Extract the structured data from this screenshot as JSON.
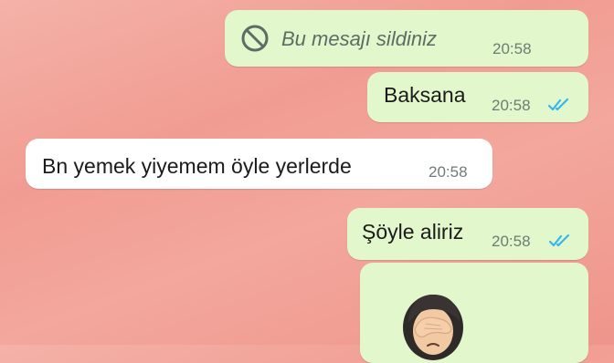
{
  "messages": [
    {
      "id": "m1",
      "direction": "outgoing",
      "deleted": true,
      "text": "Bu mesajı sildiniz",
      "time": "20:58",
      "icon": "ban-icon"
    },
    {
      "id": "m2",
      "direction": "outgoing",
      "text": "Baksana",
      "time": "20:58",
      "status": "read"
    },
    {
      "id": "m3",
      "direction": "incoming",
      "text": "Bn yemek yiyemem öyle yerlerde",
      "time": "20:58"
    },
    {
      "id": "m4",
      "direction": "outgoing",
      "text": "Şöyle aliriz",
      "time": "20:58",
      "status": "read"
    },
    {
      "id": "m5",
      "direction": "outgoing",
      "type": "emoji",
      "emoji": "woman-facepalming"
    }
  ],
  "colors": {
    "outgoing_bubble": "#e2f7cb",
    "incoming_bubble": "#ffffff",
    "read_ticks": "#34b7f1",
    "background": "#f3a79d"
  }
}
